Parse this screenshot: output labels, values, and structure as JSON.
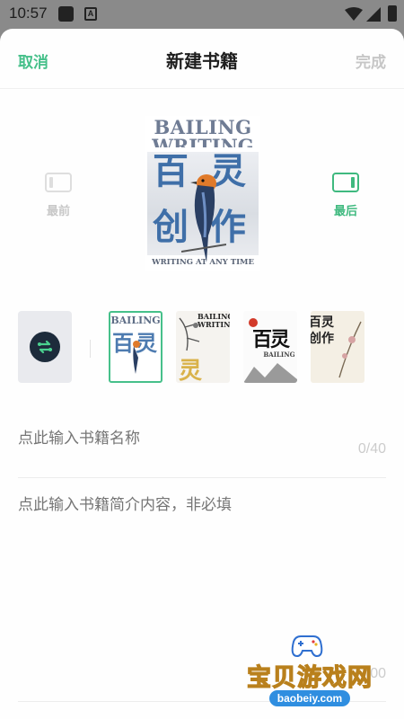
{
  "status_bar": {
    "time": "10:57",
    "a_icon": "A"
  },
  "header": {
    "cancel_label": "取消",
    "title": "新建书籍",
    "done_label": "完成"
  },
  "cover_nav": {
    "prev_label": "最前",
    "next_label": "最后"
  },
  "cover": {
    "title_line1": "BAILING",
    "title_line2": "WRITING",
    "big_chars": [
      "百",
      "灵",
      "创",
      "作"
    ],
    "tagline": "WRITING AT ANY TIME"
  },
  "cover_styles": {
    "style_button_icon": "swap-icon",
    "thumbnails": [
      {
        "id": 1,
        "selected": true,
        "title": "BAILING",
        "chars": "百灵"
      },
      {
        "id": 2,
        "selected": false,
        "title": "BAILING WRITING",
        "chars": "灵"
      },
      {
        "id": 3,
        "selected": false,
        "title": "BAILING",
        "chars": "百灵"
      },
      {
        "id": 4,
        "selected": false,
        "title": "",
        "chars": "百灵创作"
      }
    ]
  },
  "form": {
    "name_placeholder": "点此输入书籍名称",
    "name_counter": "0/40",
    "intro_placeholder": "点此输入书籍简介内容，非必填",
    "intro_counter": "00"
  },
  "watermark": {
    "text": "宝贝游戏网",
    "url": "baobeiy.com"
  },
  "colors": {
    "accent": "#46c08a",
    "disabled": "#c6c6c6",
    "cover_blue": "#3f6fa8"
  }
}
